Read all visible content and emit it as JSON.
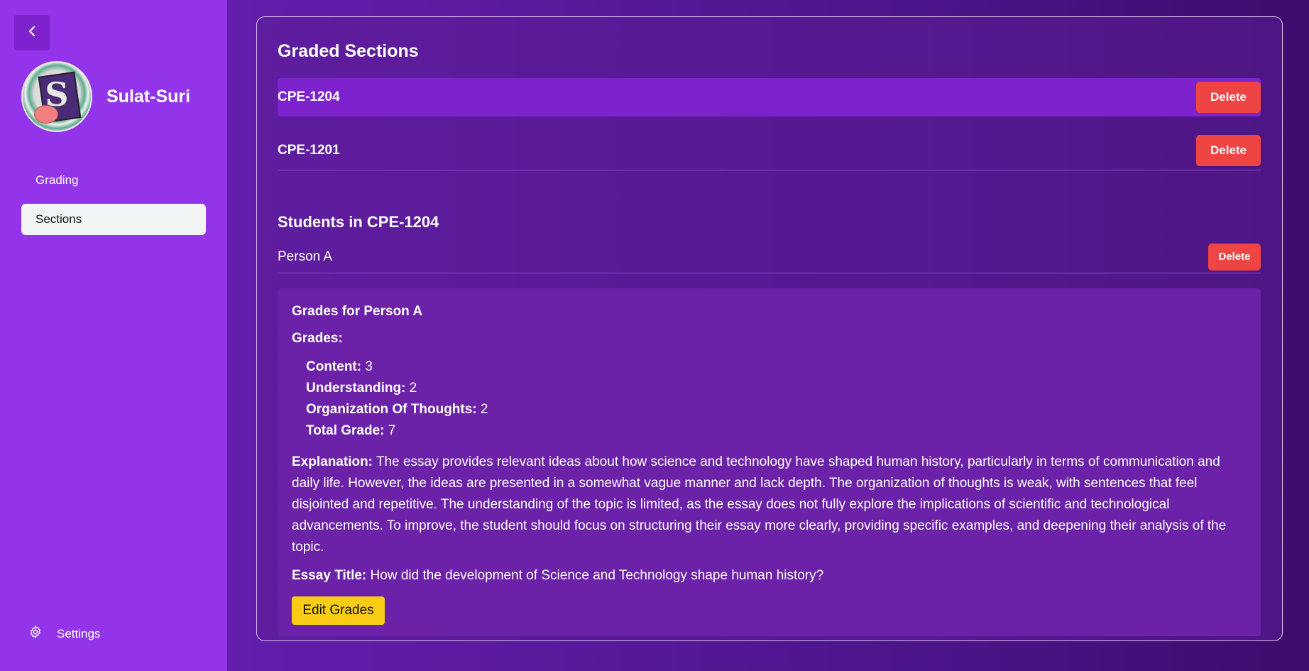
{
  "sidebar": {
    "back_icon": "chevron-left-icon",
    "app_name": "Sulat-Suri",
    "nav": [
      {
        "label": "Grading",
        "active": false
      },
      {
        "label": "Sections",
        "active": true
      }
    ],
    "settings_label": "Settings",
    "settings_icon": "gear-icon"
  },
  "main": {
    "graded_sections_title": "Graded Sections",
    "sections": [
      {
        "code": "CPE-1204",
        "delete_label": "Delete",
        "selected": true
      },
      {
        "code": "CPE-1201",
        "delete_label": "Delete",
        "selected": false
      }
    ],
    "students_title": "Students in CPE-1204",
    "students": [
      {
        "name": "Person A",
        "delete_label": "Delete"
      }
    ],
    "grades": {
      "title": "Grades for Person A",
      "label": "Grades:",
      "items": [
        {
          "name": "Content:",
          "value": "3"
        },
        {
          "name": "Understanding:",
          "value": "2"
        },
        {
          "name": "Organization Of Thoughts:",
          "value": "2"
        },
        {
          "name": "Total Grade:",
          "value": "7"
        }
      ],
      "explanation_label": "Explanation:",
      "explanation": "The essay provides relevant ideas about how science and technology have shaped human history, particularly in terms of communication and daily life. However, the ideas are presented in a somewhat vague manner and lack depth. The organization of thoughts is weak, with sentences that feel disjointed and repetitive. The understanding of the topic is limited, as the essay does not fully explore the implications of scientific and technological advancements. To improve, the student should focus on structuring their essay more clearly, providing specific examples, and deepening their analysis of the topic.",
      "essay_title_label": "Essay Title:",
      "essay_title": "How did the development of Science and Technology shape human history?",
      "edit_button_label": "Edit Grades"
    }
  },
  "colors": {
    "sidebar_bg": "#9333ea",
    "selected_row": "#7e22ce",
    "delete_button": "#ef4444",
    "edit_button": "#facc15",
    "grades_box": "#6b21a8"
  }
}
